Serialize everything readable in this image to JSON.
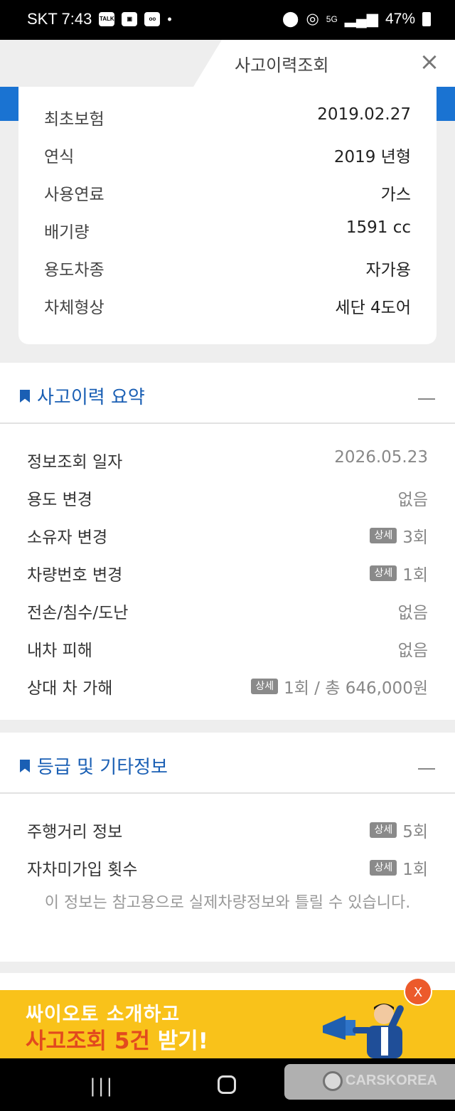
{
  "status_bar": {
    "carrier_time": "SKT 7:43",
    "talk_icon": "TALK",
    "battery": "47%",
    "signal_label": "5G"
  },
  "header": {
    "title": "사고이력조회",
    "close_icon": "×"
  },
  "car_info": [
    {
      "label": "최초보험",
      "value": "2019.02.27"
    },
    {
      "label": "연식",
      "value": "2019 년형"
    },
    {
      "label": "사용연료",
      "value": "가스"
    },
    {
      "label": "배기량",
      "value": "1591 cc"
    },
    {
      "label": "용도차종",
      "value": "자가용"
    },
    {
      "label": "차체형상",
      "value": "세단 4도어"
    }
  ],
  "summary": {
    "title": "사고이력 요약",
    "rows": [
      {
        "label": "정보조회 일자",
        "value": "2026.05.23"
      },
      {
        "label": "용도 변경",
        "value": "없음"
      },
      {
        "label": "소유자 변경",
        "badge": "상세",
        "value": "3회"
      },
      {
        "label": "차량번호 변경",
        "badge": "상세",
        "value": "1회"
      },
      {
        "label": "전손/침수/도난",
        "value": "없음"
      },
      {
        "label": "내차 피해",
        "value": "없음"
      },
      {
        "label": "상대 차 가해",
        "badge": "상세",
        "value": "1회 / 총 646,000원"
      }
    ]
  },
  "grade": {
    "title": "등급 및 기타정보",
    "rows": [
      {
        "label": "주행거리 정보",
        "badge": "상세",
        "value": "5회"
      },
      {
        "label": "자차미가입 횟수",
        "badge": "상세",
        "value": "1회"
      }
    ],
    "note": "이 정보는 참고용으로 실제차량정보와 틀릴 수 있습니다."
  },
  "banner": {
    "line1": "싸이오토 소개하고",
    "line2_highlight": "사고조회 5건",
    "line2_white": "받기!",
    "close_label": "X"
  },
  "carskorea": {
    "label": "CARSKOREA"
  },
  "colors": {
    "accent": "#1a5fb4",
    "header_blue": "#1a73d2",
    "banner_bg": "#f9c21a",
    "banner_red": "#e24a1e"
  }
}
